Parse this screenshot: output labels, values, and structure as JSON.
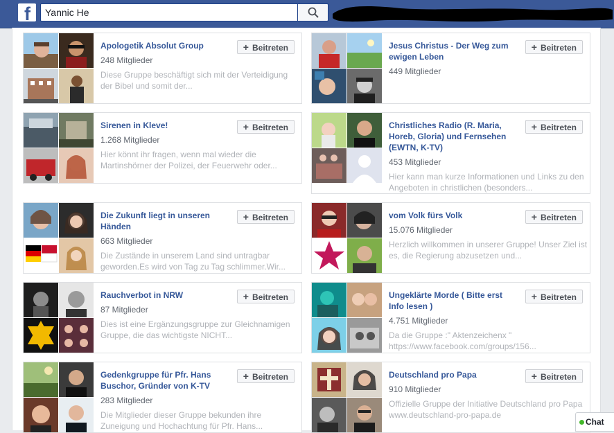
{
  "search": {
    "value": "Yannic He"
  },
  "brand": {
    "logo_letter": "f",
    "color": "#3b5998"
  },
  "join_label": "Beitreten",
  "chat": {
    "label": "Chat"
  },
  "groups": [
    {
      "name": "Apologetik Absolut Group",
      "members": "248 Mitglieder",
      "description": "Diese Gruppe beschäftigt sich mit der Verteidigung der Bibel und somit der..."
    },
    {
      "name": "Jesus Christus - Der Weg zum ewigen Leben",
      "members": "449 Mitglieder",
      "description": ""
    },
    {
      "name": "Sirenen in Kleve!",
      "members": "1.268 Mitglieder",
      "description": "Hier könnt ihr fragen, wenn mal wieder die Martinshörner der Polizei, der Feuerwehr oder..."
    },
    {
      "name": "Christliches Radio (R. Maria, Horeb, Gloria) und Fernsehen (EWTN, K-TV)",
      "members": "453 Mitglieder",
      "description": "Hier kann man kurze Informationen und Links zu den Angeboten in christlichen (besonders..."
    },
    {
      "name": "Die Zukunft liegt in unseren Händen",
      "members": "663 Mitglieder",
      "description": "Die Zustände in unserem Land sind untragbar geworden.Es wird von Tag zu Tag schlimmer.Wir..."
    },
    {
      "name": "vom Volk fürs Volk",
      "members": "15.076 Mitglieder",
      "description": "Herzlich willkommen in unserer Gruppe! Unser Ziel ist es, die Regierung abzusetzen und..."
    },
    {
      "name": "Rauchverbot in NRW",
      "members": "87 Mitglieder",
      "description": "Dies ist eine Ergänzungsgruppe zur Gleichnamigen Gruppe, die das wichtigste NICHT..."
    },
    {
      "name": "Ungeklärte Morde ( Bitte erst Info lesen )",
      "members": "4.751 Mitglieder",
      "description": "Da die Gruppe :\" Aktenzeichenx \" https://www.facebook.com/groups/156..."
    },
    {
      "name": "Gedenkgruppe für Pfr. Hans Buschor, Gründer von K-TV",
      "members": "283 Mitglieder",
      "description": "Die Mitglieder dieser Gruppe bekunden ihre Zuneigung und Hochachtung für Pfr. Hans..."
    },
    {
      "name": "Deutschland pro Papa",
      "members": "910 Mitglieder",
      "description": "Offizielle Gruppe der Initiative Deutschland pro Papa www.deutschland-pro-papa.de"
    }
  ]
}
